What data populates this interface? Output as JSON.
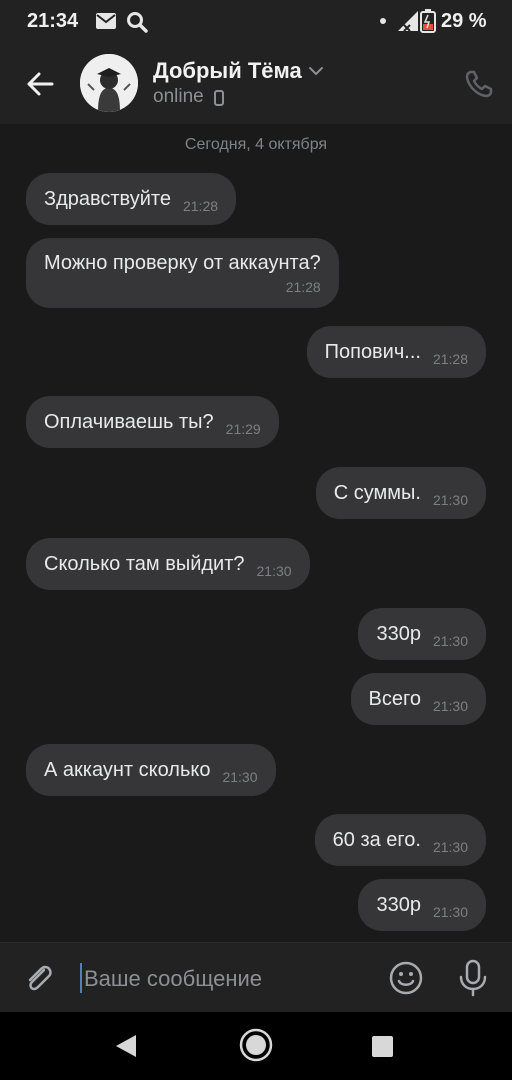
{
  "status_bar": {
    "time": "21:34",
    "battery_percent": "29 %",
    "icons": [
      "mail-icon",
      "search-icon",
      "notification-dot",
      "signal-icon",
      "battery-icon"
    ]
  },
  "header": {
    "contact_name": "Добрый Тёма",
    "status": "online",
    "icons": [
      "back-arrow-icon",
      "avatar",
      "chevron-down-icon",
      "mobile-icon",
      "phone-icon"
    ]
  },
  "chat": {
    "date_separator": "Сегодня, 4 октября",
    "messages": [
      {
        "direction": "in",
        "text": "Здравствуйте",
        "time": "21:28"
      },
      {
        "direction": "in",
        "text": "Можно проверку от аккаунта?",
        "time": "21:28"
      },
      {
        "direction": "out",
        "text": "Попович...",
        "time": "21:28"
      },
      {
        "direction": "in",
        "text": "Оплачиваешь ты?",
        "time": "21:29"
      },
      {
        "direction": "out",
        "text": "С суммы.",
        "time": "21:30"
      },
      {
        "direction": "in",
        "text": "Сколько там выйдит?",
        "time": "21:30"
      },
      {
        "direction": "out",
        "text": "330р",
        "time": "21:30"
      },
      {
        "direction": "out",
        "text": "Всего",
        "time": "21:30"
      },
      {
        "direction": "in",
        "text": "А аккаунт сколько",
        "time": "21:30"
      },
      {
        "direction": "out",
        "text": "60 за его.",
        "time": "21:30"
      },
      {
        "direction": "out",
        "text": "330р",
        "time": "21:30"
      }
    ]
  },
  "composer": {
    "placeholder": "Ваше сообщение",
    "value": ""
  },
  "colors": {
    "background": "#1a1a1a",
    "bar": "#222222",
    "bubble": "#363638",
    "accent": "#5181b8"
  }
}
